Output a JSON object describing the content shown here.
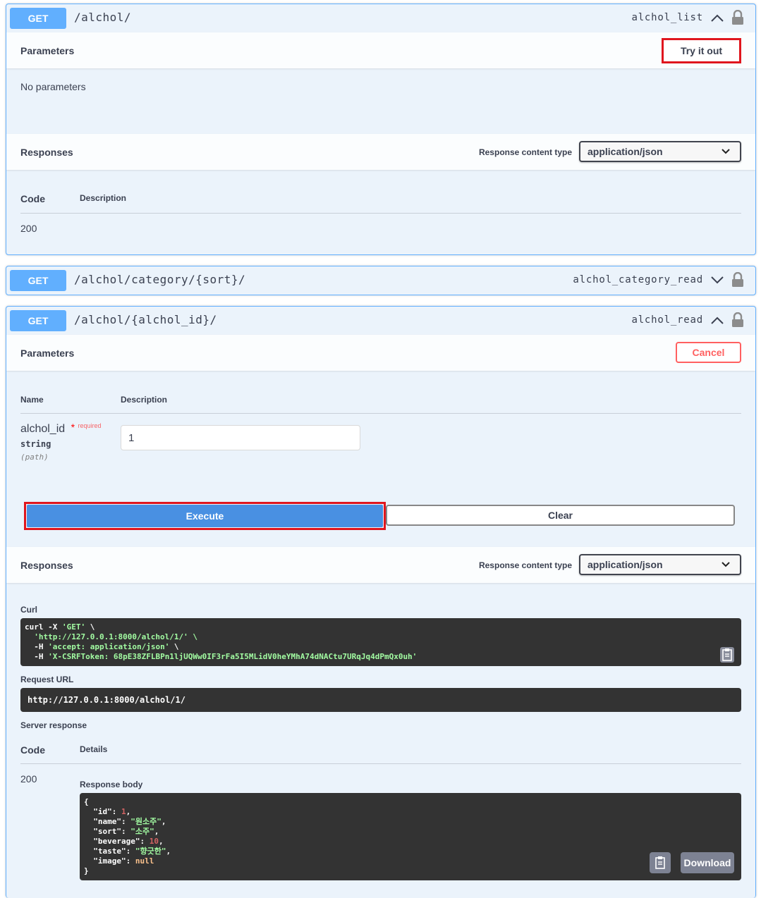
{
  "op1": {
    "method": "GET",
    "path": "/alchol/",
    "operation_id": "alchol_list",
    "parameters_title": "Parameters",
    "try_button": "Try it out",
    "no_params": "No parameters",
    "responses_title": "Responses",
    "content_type_label": "Response content type",
    "content_type_value": "application/json",
    "col_code": "Code",
    "col_description": "Description",
    "code_value": "200"
  },
  "op2": {
    "method": "GET",
    "path": "/alchol/category/{sort}/",
    "operation_id": "alchol_category_read"
  },
  "op3": {
    "method": "GET",
    "path": "/alchol/{alchol_id}/",
    "operation_id": "alchol_read",
    "parameters_title": "Parameters",
    "cancel_button": "Cancel",
    "col_name": "Name",
    "col_description": "Description",
    "param": {
      "name": "alchol_id",
      "required_star": "*",
      "required_label": "required",
      "type": "string",
      "location": "(path)",
      "value": "1"
    },
    "execute_button": "Execute",
    "clear_button": "Clear",
    "responses_title": "Responses",
    "content_type_label": "Response content type",
    "content_type_value": "application/json",
    "curl_label": "Curl",
    "curl_lines": [
      "curl -X 'GET' \\",
      "  'http://127.0.0.1:8000/alchol/1/' \\",
      "  -H 'accept: application/json' \\",
      "  -H 'X-CSRFToken: 68pE38ZFLBPn1ljUQWw0IF3rFa5I5MLidV0heYMhA74dNACtu7URqJq4dPmQx0uh'"
    ],
    "request_url_label": "Request URL",
    "request_url": "http://127.0.0.1:8000/alchol/1/",
    "server_response_label": "Server response",
    "col_code": "Code",
    "col_details": "Details",
    "code_value": "200",
    "response_body_label": "Response body",
    "response_body": {
      "open": "{",
      "close": "}",
      "fields": [
        {
          "key": "\"id\"",
          "value": "1",
          "kind": "num",
          "comma": ","
        },
        {
          "key": "\"name\"",
          "value": "\"원소주\"",
          "kind": "str",
          "comma": ","
        },
        {
          "key": "\"sort\"",
          "value": "\"소주\"",
          "kind": "str",
          "comma": ","
        },
        {
          "key": "\"beverage\"",
          "value": "10",
          "kind": "num",
          "comma": ","
        },
        {
          "key": "\"taste\"",
          "value": "\"향긋한\"",
          "kind": "str",
          "comma": ","
        },
        {
          "key": "\"image\"",
          "value": "null",
          "kind": "kw",
          "comma": ""
        }
      ]
    },
    "download_button": "Download"
  },
  "colors": {
    "get": "#61affe",
    "execute": "#4990e2",
    "highlight": "#e0161e",
    "cancel": "#ff6060",
    "code_bg": "#333333"
  }
}
